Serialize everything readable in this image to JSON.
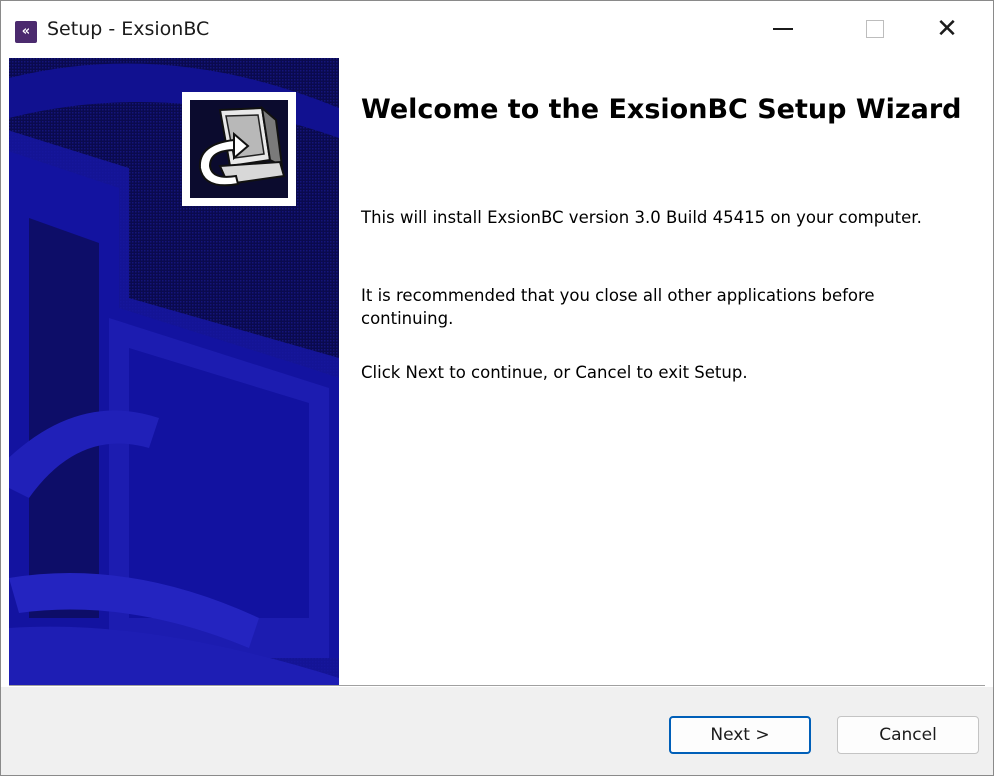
{
  "window": {
    "title": "Setup - ExsionBC",
    "icon_glyph": "«"
  },
  "titlebar": {
    "minimize_icon": "minimize-icon",
    "maximize_icon": "maximize-icon",
    "close_icon": "close-icon",
    "close_glyph": "✕"
  },
  "banner": {
    "background_color": "#0a0a4e",
    "pattern_color": "#1a1aa0",
    "logo_icon": "computer-install-icon"
  },
  "content": {
    "heading": "Welcome to the ExsionBC Setup Wizard",
    "paragraph_1": "This will install ExsionBC version 3.0 Build 45415 on your computer.",
    "paragraph_2": "It is recommended that you close all other applications before continuing.",
    "paragraph_3": "Click Next to continue, or Cancel to exit Setup."
  },
  "footer": {
    "next_label": "Next >",
    "cancel_label": "Cancel",
    "accent_color": "#005fb8"
  }
}
